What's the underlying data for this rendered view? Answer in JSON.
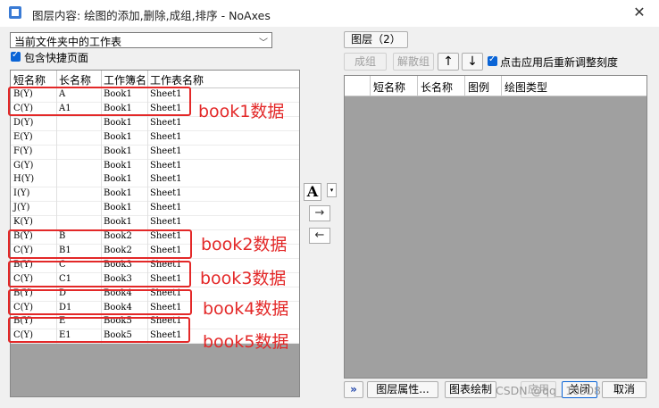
{
  "window": {
    "title": "图层内容: 绘图的添加,删除,成组,排序 - NoAxes",
    "close_glyph": "✕"
  },
  "left_panel": {
    "source_dropdown": "当前文件夹中的工作表",
    "include_shortcut_label": "包含快捷页面",
    "include_shortcut_checked": true,
    "columns": [
      "短名称",
      "长名称",
      "工作簿名",
      "工作表名称"
    ],
    "rows": [
      {
        "short": "B(Y)",
        "long": "A",
        "book": "Book1",
        "sheet": "Sheet1"
      },
      {
        "short": "C(Y)",
        "long": "A1",
        "book": "Book1",
        "sheet": "Sheet1"
      },
      {
        "short": "D(Y)",
        "long": "",
        "book": "Book1",
        "sheet": "Sheet1"
      },
      {
        "short": "E(Y)",
        "long": "",
        "book": "Book1",
        "sheet": "Sheet1"
      },
      {
        "short": "F(Y)",
        "long": "",
        "book": "Book1",
        "sheet": "Sheet1"
      },
      {
        "short": "G(Y)",
        "long": "",
        "book": "Book1",
        "sheet": "Sheet1"
      },
      {
        "short": "H(Y)",
        "long": "",
        "book": "Book1",
        "sheet": "Sheet1"
      },
      {
        "short": "I(Y)",
        "long": "",
        "book": "Book1",
        "sheet": "Sheet1"
      },
      {
        "short": "J(Y)",
        "long": "",
        "book": "Book1",
        "sheet": "Sheet1"
      },
      {
        "short": "K(Y)",
        "long": "",
        "book": "Book1",
        "sheet": "Sheet1"
      },
      {
        "short": "B(Y)",
        "long": "B",
        "book": "Book2",
        "sheet": "Sheet1"
      },
      {
        "short": "C(Y)",
        "long": "B1",
        "book": "Book2",
        "sheet": "Sheet1"
      },
      {
        "short": "B(Y)",
        "long": "C",
        "book": "Book3",
        "sheet": "Sheet1"
      },
      {
        "short": "C(Y)",
        "long": "C1",
        "book": "Book3",
        "sheet": "Sheet1"
      },
      {
        "short": "B(Y)",
        "long": "D",
        "book": "Book4",
        "sheet": "Sheet1"
      },
      {
        "short": "C(Y)",
        "long": "D1",
        "book": "Book4",
        "sheet": "Sheet1"
      },
      {
        "short": "B(Y)",
        "long": "E",
        "book": "Book5",
        "sheet": "Sheet1"
      },
      {
        "short": "C(Y)",
        "long": "E1",
        "book": "Book5",
        "sheet": "Sheet1"
      }
    ]
  },
  "annotations": {
    "book1": "book1数据",
    "book2": "book2数据",
    "book3": "book3数据",
    "book4": "book4数据",
    "book5": "book5数据",
    "color": "#e32828"
  },
  "middle": {
    "text_button": "A",
    "dropdown_glyph": "▾",
    "add_glyph": "→",
    "remove_glyph": "←"
  },
  "right_panel": {
    "layer_tab": "图层（2）",
    "group_button": "成组",
    "ungroup_button": "解散组",
    "move_up_glyph": "↑",
    "move_down_glyph": "↓",
    "rescale_label": "点击应用后重新调整刻度",
    "rescale_checked": true,
    "columns": [
      "短名称",
      "长名称",
      "图例",
      "绘图类型"
    ]
  },
  "footer": {
    "expand_button": "»",
    "layer_props_button": "图层属性...",
    "plot_button": "图表绘制",
    "apply_button": "应用",
    "close_button": "关闭",
    "cancel_button": "取消",
    "watermark": "CSDN @qq_     10308"
  }
}
